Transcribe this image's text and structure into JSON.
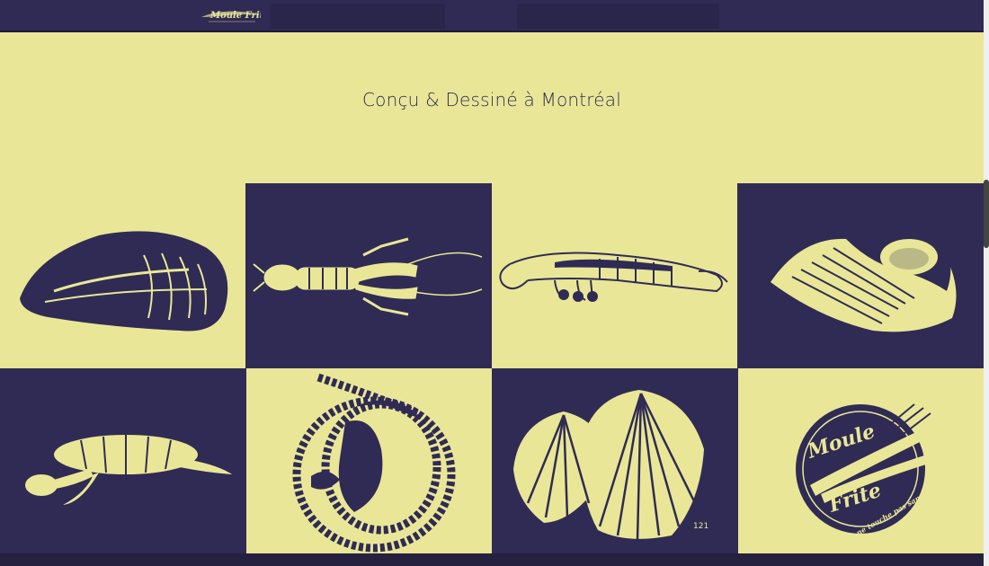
{
  "header": {
    "logo": {
      "name": "Moule Frite",
      "tagline": "On ne touche pas sans être touché"
    }
  },
  "hero": {
    "title": "Conçu & Dessiné à Montréal"
  },
  "gallery": {
    "items": [
      {
        "subject": "mussel"
      },
      {
        "subject": "lobster"
      },
      {
        "subject": "shrimp"
      },
      {
        "subject": "conch shell"
      },
      {
        "subject": "sea turtle"
      },
      {
        "subject": "rope coil"
      },
      {
        "subject": "scallop shells",
        "caption": "121"
      },
      {
        "subject": "logo"
      }
    ]
  },
  "colors": {
    "navy": "#302b54",
    "cream": "#e9e797"
  }
}
